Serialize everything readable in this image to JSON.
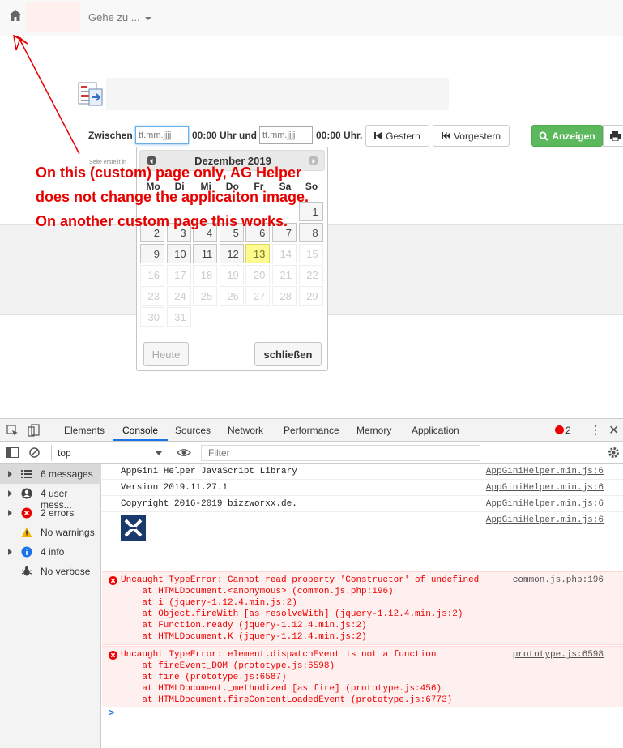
{
  "navbar": {
    "goto_label": "Gehe zu ..."
  },
  "filter": {
    "zwischen_label": "Zwischen",
    "from_placeholder": "tt.mm.jjjj",
    "from_time": "00:00 Uhr und",
    "to_placeholder": "tt.mm.jjjj",
    "to_time": "00:00 Uhr.",
    "btn_gestern": "Gestern",
    "btn_vorgestern": "Vorgestern",
    "btn_anzeigen": "Anzeigen",
    "tiny_text": "Seite erstellt in"
  },
  "datepicker": {
    "title": "Dezember 2019",
    "weekdays": [
      "Mo",
      "Di",
      "Mi",
      "Do",
      "Fr",
      "Sa",
      "So"
    ],
    "rows": [
      [
        "",
        "",
        "",
        "",
        "",
        "",
        "1"
      ],
      [
        "2",
        "3",
        "4",
        "5",
        "6",
        "7",
        "8"
      ],
      [
        "9",
        "10",
        "11",
        "12",
        "13",
        "14",
        "15"
      ],
      [
        "16",
        "17",
        "18",
        "19",
        "20",
        "21",
        "22"
      ],
      [
        "23",
        "24",
        "25",
        "26",
        "27",
        "28",
        "29"
      ],
      [
        "30",
        "31",
        "",
        "",
        "",
        "",
        ""
      ]
    ],
    "today": "13",
    "btn_today": "Heute",
    "btn_close": "schließen"
  },
  "annotation": {
    "line1": "On this (custom) page only, AG Helper",
    "line2": "does not change the applicaiton image.",
    "line3": "On another custom page this works."
  },
  "devtools": {
    "tabs": [
      "Elements",
      "Console",
      "Sources",
      "Network",
      "Performance",
      "Memory",
      "Application"
    ],
    "active_tab": "Console",
    "error_count": "2",
    "context": "top",
    "filter_placeholder": "Filter",
    "sidebar": [
      {
        "label": "6 messages",
        "icon": "list-icon"
      },
      {
        "label": "4 user mess...",
        "icon": "user-icon"
      },
      {
        "label": "2 errors",
        "icon": "error-icon"
      },
      {
        "label": "No warnings",
        "icon": "warning-icon"
      },
      {
        "label": "4 info",
        "icon": "info-icon"
      },
      {
        "label": "No verbose",
        "icon": "bug-icon"
      }
    ],
    "logs": [
      {
        "msg": "AppGini Helper JavaScript Library",
        "src": "AppGiniHelper.min.js:6"
      },
      {
        "msg": "Version 2019.11.27.1",
        "src": "AppGiniHelper.min.js:6"
      },
      {
        "msg": "Copyright 2016-2019 bizzworxx.de.",
        "src": "AppGiniHelper.min.js:6"
      },
      {
        "msg": "",
        "src": "AppGiniHelper.min.js:6"
      }
    ],
    "errors": [
      {
        "src": "common.js.php:196",
        "lines": [
          "Uncaught TypeError: Cannot read property 'Constructor' of undefined",
          "    at HTMLDocument.<anonymous> (common.js.php:196)",
          "    at i (jquery-1.12.4.min.js:2)",
          "    at Object.fireWith [as resolveWith] (jquery-1.12.4.min.js:2)",
          "    at Function.ready (jquery-1.12.4.min.js:2)",
          "    at HTMLDocument.K (jquery-1.12.4.min.js:2)"
        ]
      },
      {
        "src": "prototype.js:6598",
        "lines": [
          "Uncaught TypeError: element.dispatchEvent is not a function",
          "    at fireEvent_DOM (prototype.js:6598)",
          "    at fire (prototype.js:6587)",
          "    at HTMLDocument._methodized [as fire] (prototype.js:456)",
          "    at HTMLDocument.fireContentLoadedEvent (prototype.js:6773)"
        ]
      }
    ],
    "prompt": ">"
  }
}
